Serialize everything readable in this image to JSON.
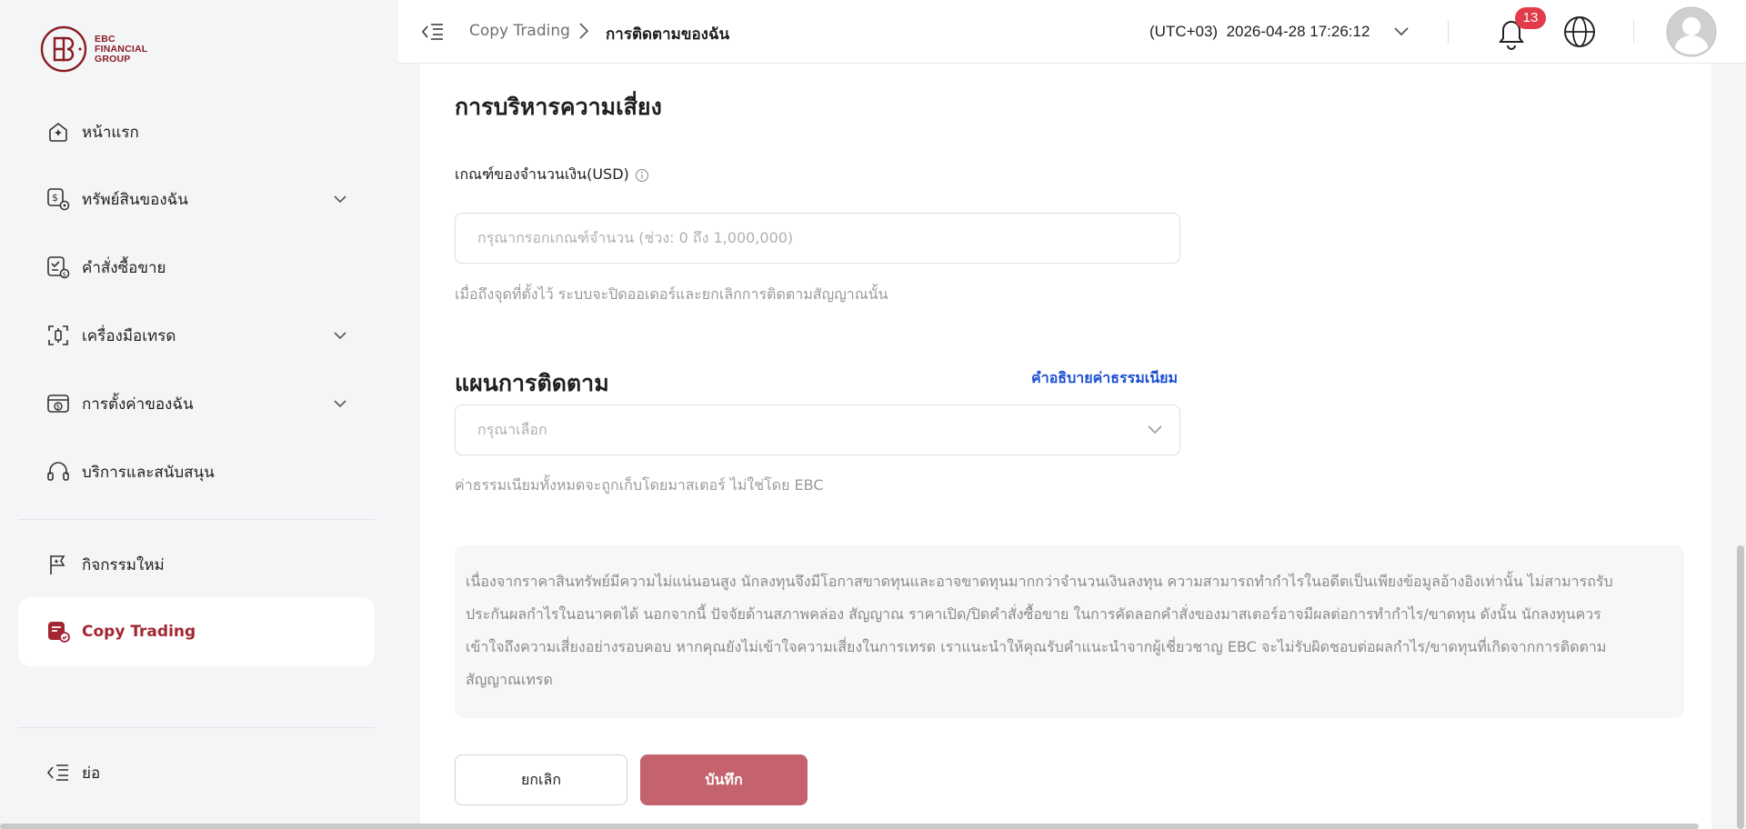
{
  "brand": {
    "line1": "EBC",
    "line2": "FINANCIAL",
    "line3": "GROUP"
  },
  "sidebar": {
    "items": [
      {
        "label": "หน้าแรก",
        "icon": "home-icon"
      },
      {
        "label": "ทรัพย์สินของฉัน",
        "icon": "assets-icon"
      },
      {
        "label": "คำสั่งซื้อขาย",
        "icon": "orders-icon"
      },
      {
        "label": "เครื่องมือเทรด",
        "icon": "tools-icon"
      },
      {
        "label": "การตั้งค่าของฉัน",
        "icon": "settings-icon"
      },
      {
        "label": "บริการและสนับสนุน",
        "icon": "headset-icon"
      },
      {
        "label": "กิจกรรมใหม่",
        "icon": "flag-icon"
      },
      {
        "label": "Copy Trading",
        "icon": "copy-trading-icon"
      }
    ],
    "collapse_label": "ย่อ"
  },
  "header": {
    "breadcrumb": [
      "Copy Trading",
      "การติดตามของฉัน"
    ],
    "timezone": "(UTC+03)",
    "datetime": "2026-04-28 17:26:12",
    "notification_count": "13"
  },
  "risk": {
    "title": "การบริหารความเสี่ยง",
    "amount_label": "เกณฑ์ของจำนวนเงิน(USD)",
    "amount_placeholder": "กรุณากรอกเกณฑ์จำนวน (ช่วง: 0 ถึง 1,000,000)",
    "amount_hint": "เมื่อถึงจุดที่ตั้งไว้ ระบบจะปิดออเดอร์และยกเลิกการติดตามสัญญาณนั้น"
  },
  "plan": {
    "title": "แผนการติดตาม",
    "fee_link": "คำอธิบายค่าธรรมเนียม",
    "select_placeholder": "กรุณาเลือก",
    "hint": "ค่าธรรมเนียมทั้งหมดจะถูกเก็บโดยมาสเตอร์ ไม่ใช่โดย EBC"
  },
  "disclaimer": {
    "line1": "เนื่องจากราคาสินทรัพย์มีความไม่แน่นอนสูง นักลงทุนจึงมีโอกาสขาดทุนและอาจขาดทุนมากกว่าจำนวนเงินลงทุน ความสามารถทำกำไรในอดีตเป็นเพียงข้อมูลอ้างอิงเท่านั้น ไม่สามารถรับ",
    "line2": "ประกันผลกำไรในอนาคตได้ นอกจากนี้ ปัจจัยด้านสภาพคล่อง สัญญาณ ราคาเปิด/ปิดคำสั่งซื้อขาย ในการคัดลอกคำสั่งของมาสเตอร์อาจมีผลต่อการทำกำไร/ขาดทุน ดังนั้น นักลงทุนควร",
    "line3": "เข้าใจถึงความเสี่ยงอย่างรอบคอบ หากคุณยังไม่เข้าใจความเสี่ยงในการเทรด เราแนะนำให้คุณรับคำแนะนำจากผู้เชี่ยวชาญ EBC จะไม่รับผิดชอบต่อผลกำไร/ขาดทุนที่เกิดจากการติดตาม",
    "line4": "สัญญาณเทรด"
  },
  "actions": {
    "cancel": "ยกเลิก",
    "save": "บันทึก"
  },
  "colors": {
    "brand": "#a32632",
    "save_button": "#c4636d",
    "link": "#1b4fd1",
    "badge": "#e23b4a"
  }
}
